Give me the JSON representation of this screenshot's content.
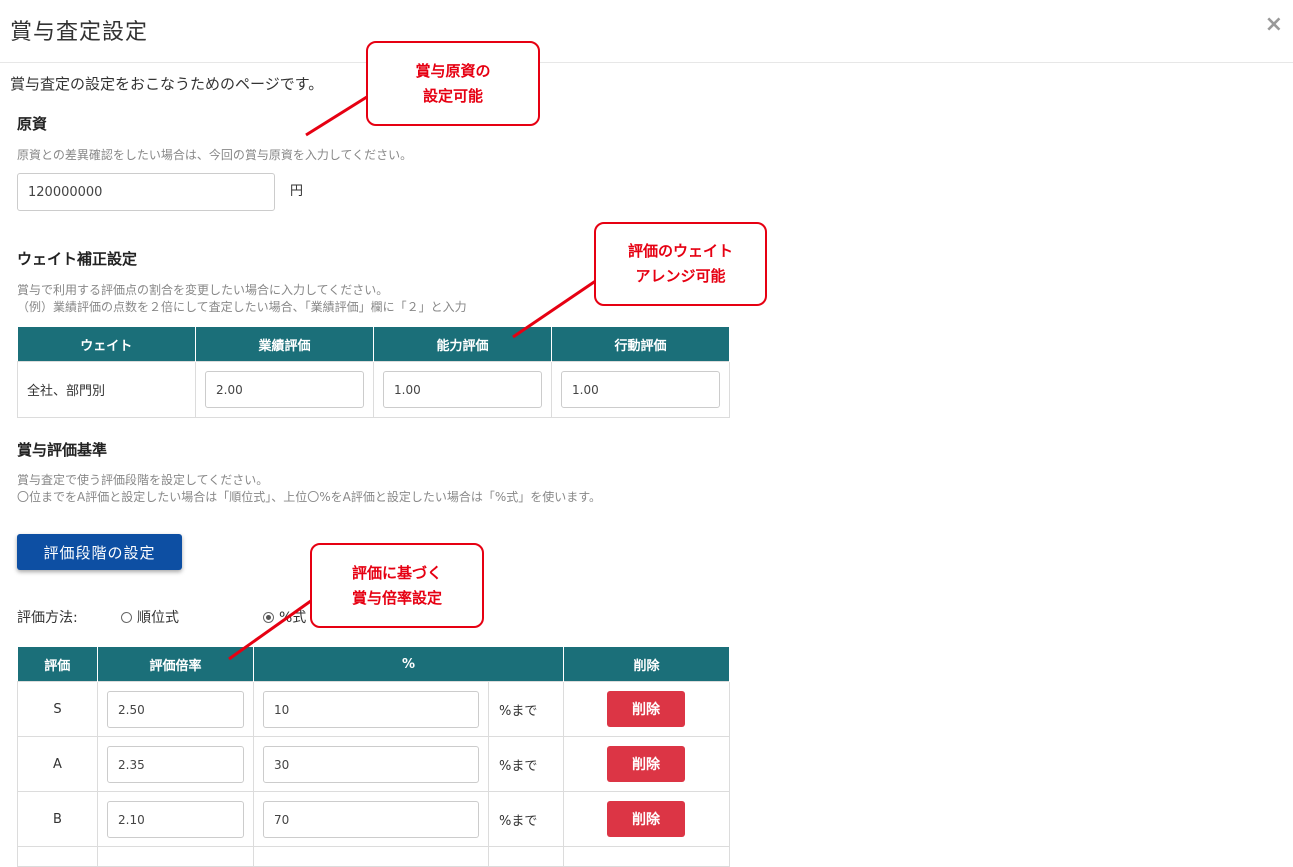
{
  "dialog": {
    "title": "賞与査定設定",
    "close_label": "×",
    "intro": "賞与査定の設定をおこなうためのページです。"
  },
  "capital": {
    "title": "原資",
    "help": "原資との差異確認をしたい場合は、今回の賞与原資を入力してください。",
    "value": "120000000",
    "unit": "円"
  },
  "weight": {
    "title": "ウェイト補正設定",
    "help_line1": "賞与で利用する評価点の割合を変更したい場合に入力してください。",
    "help_line2": "（例）業績評価の点数を２倍にして査定したい場合、「業績評価」欄に「２」と入力",
    "headers": [
      "ウェイト",
      "業績評価",
      "能力評価",
      "行動評価"
    ],
    "row_label": "全社、部門別",
    "values": [
      "2.00",
      "1.00",
      "1.00"
    ]
  },
  "criteria": {
    "title": "賞与評価基準",
    "help_line1": "賞与査定で使う評価段階を設定してください。",
    "help_line2": "〇位までをA評価と設定したい場合は「順位式」、上位〇%をA評価と設定したい場合は「%式」を使います。",
    "button_label": "評価段階の設定",
    "method_label": "評価方法:",
    "methods": [
      {
        "label": "順位式",
        "checked": false
      },
      {
        "label": "%式",
        "checked": true
      }
    ],
    "headers": [
      "評価",
      "評価倍率",
      "%",
      "削除"
    ],
    "unit_suffix": "%まで",
    "delete_label": "削除",
    "rows": [
      {
        "grade": "S",
        "rate": "2.50",
        "percent": "10"
      },
      {
        "grade": "A",
        "rate": "2.35",
        "percent": "30"
      },
      {
        "grade": "B",
        "rate": "2.10",
        "percent": "70"
      }
    ]
  },
  "callouts": {
    "capital": "賞与原資の\n設定可能",
    "weight": "評価のウェイト\nアレンジ可能",
    "rate": "評価に基づく\n賞与倍率設定"
  },
  "colors": {
    "header_teal": "#1b6f79",
    "primary_blue": "#0d4fa3",
    "danger_red": "#dc3545",
    "callout_red": "#e60012"
  }
}
